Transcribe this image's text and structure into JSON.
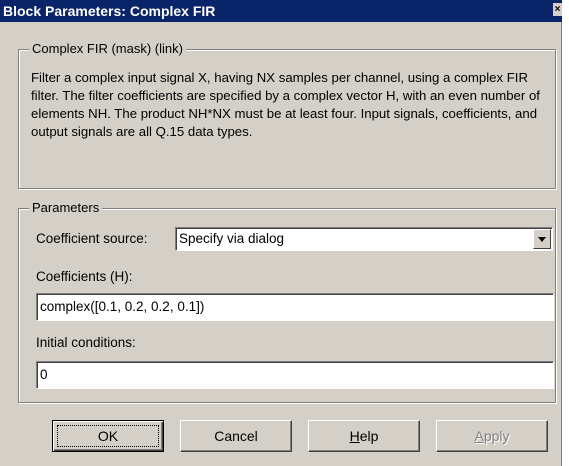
{
  "window": {
    "title": "Block Parameters: Complex FIR",
    "close_glyph": "×"
  },
  "description_group": {
    "title": "Complex FIR (mask) (link)",
    "text": "Filter a complex input signal X, having NX samples per channel, using a complex FIR filter. The filter coefficients are specified by a complex vector H, with an even number of elements NH. The product NH*NX must be at least four. Input signals, coefficients, and output signals are all Q.15 data types."
  },
  "parameters_group": {
    "title": "Parameters",
    "coefficient_source": {
      "label": "Coefficient source:",
      "selected_value": "Specify via dialog"
    },
    "coefficients": {
      "label": "Coefficients (H):",
      "value": "complex([0.1, 0.2, 0.2, 0.1])"
    },
    "initial_conditions": {
      "label": "Initial conditions:",
      "value": "0"
    }
  },
  "buttons": {
    "ok": "OK",
    "cancel": "Cancel",
    "help_first": "H",
    "help_rest": "elp",
    "apply_first": "A",
    "apply_rest": "pply"
  },
  "icons": {
    "close": "close-icon",
    "dropdown": "chevron-down-icon"
  },
  "colors": {
    "titlebar": "#0a246a",
    "dialog_face": "#d4d0c8",
    "disabled_text": "#808080"
  }
}
